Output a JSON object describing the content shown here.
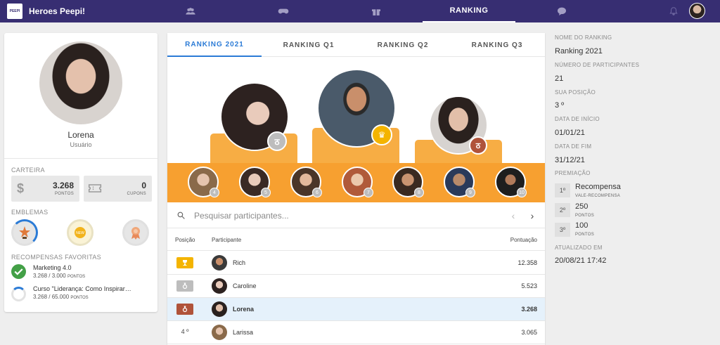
{
  "app": {
    "name": "Heroes Peepi!",
    "logo_text": "PEEPI"
  },
  "nav": {
    "items": [
      {
        "icon": "people-icon"
      },
      {
        "icon": "gamepad-icon"
      },
      {
        "icon": "gift-icon"
      },
      {
        "label": "RANKING",
        "active": true
      },
      {
        "icon": "chat-icon"
      }
    ]
  },
  "profile": {
    "name": "Lorena",
    "role": "Usuário"
  },
  "wallet": {
    "label": "CARTEIRA",
    "points": {
      "value": "3.268",
      "unit": "PONTOS",
      "icon": "dollar-icon"
    },
    "coupons": {
      "value": "0",
      "unit": "CUPONS",
      "icon": "ticket-icon"
    }
  },
  "emblems": {
    "label": "EMBLEMAS",
    "items": [
      "trophy-emblem-icon",
      "new-emblem-icon",
      "rosette-emblem-icon"
    ]
  },
  "favorites": {
    "label": "RECOMPENSAS FAVORITAS",
    "items": [
      {
        "title": "Marketing 4.0",
        "progress": "3.268 / 3.000",
        "unit": "PONTOS",
        "fraction": 1.0
      },
      {
        "title": "Curso \"Liderança: Como Inspirar e Influenciar\"",
        "progress": "3.268 / 65.000",
        "unit": "PONTOS",
        "fraction": 0.05
      }
    ]
  },
  "tabs": [
    "RANKING 2021",
    "RANKING Q1",
    "RANKING Q2",
    "RANKING Q3"
  ],
  "runners": [
    "4",
    "5",
    "6",
    "7",
    "8",
    "9",
    "10"
  ],
  "search": {
    "placeholder": "Pesquisar participantes..."
  },
  "table": {
    "headers": {
      "position": "Posição",
      "participant": "Participante",
      "score": "Pontuação"
    },
    "rows": [
      {
        "position": "1",
        "medal": "gold",
        "name": "Rich",
        "score": "12.358"
      },
      {
        "position": "2",
        "medal": "silver",
        "name": "Caroline",
        "score": "5.523"
      },
      {
        "position": "3",
        "medal": "bronze",
        "name": "Lorena",
        "score": "3.268",
        "me": true
      },
      {
        "position": "4 º",
        "name": "Larissa",
        "score": "3.065"
      }
    ]
  },
  "details": {
    "name_label": "NOME DO RANKING",
    "name_value": "Ranking 2021",
    "participants_label": "NÚMERO DE PARTICIPANTES",
    "participants_value": "21",
    "position_label": "SUA POSIÇÃO",
    "position_value": "3 º",
    "start_label": "DATA DE INÍCIO",
    "start_value": "01/01/21",
    "end_label": "DATA DE FIM",
    "end_value": "31/12/21",
    "prize_label": "PREMIAÇÃO",
    "prizes": [
      {
        "place": "1º",
        "title": "Recompensa",
        "sub": "VALE-RECOMPENSA"
      },
      {
        "place": "2º",
        "title": "250",
        "sub": "PONTOS"
      },
      {
        "place": "3º",
        "title": "100",
        "sub": "PONTOS"
      }
    ],
    "updated_label": "ATUALIZADO EM",
    "updated_value": "20/08/21 17:42"
  },
  "colors": {
    "topbar": "#372e72",
    "accent": "#2b7bd6",
    "podium": "#f7ad44",
    "gold": "#f4b400",
    "silver": "#bdbdbd",
    "bronze": "#b0533a",
    "success": "#43a047"
  }
}
